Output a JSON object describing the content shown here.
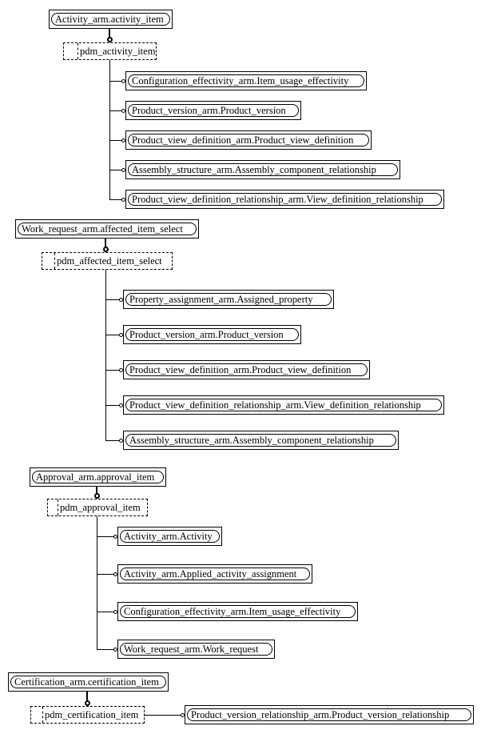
{
  "diagram": {
    "type": "EXPRESS-G select type diagram",
    "groups": [
      {
        "parent": "Activity_arm.activity_item",
        "select": "pdm_activity_item",
        "members": [
          "Configuration_effectivity_arm.Item_usage_effectivity",
          "Product_version_arm.Product_version",
          "Product_view_definition_arm.Product_view_definition",
          "Assembly_structure_arm.Assembly_component_relationship",
          "Product_view_definition_relationship_arm.View_definition_relationship"
        ]
      },
      {
        "parent": "Work_request_arm.affected_item_select",
        "select": "pdm_affected_item_select",
        "members": [
          "Property_assignment_arm.Assigned_property",
          "Product_version_arm.Product_version",
          "Product_view_definition_arm.Product_view_definition",
          "Product_view_definition_relationship_arm.View_definition_relationship",
          "Assembly_structure_arm.Assembly_component_relationship"
        ]
      },
      {
        "parent": "Approval_arm.approval_item",
        "select": "pdm_approval_item",
        "members": [
          "Activity_arm.Activity",
          "Activity_arm.Applied_activity_assignment",
          "Configuration_effectivity_arm.Item_usage_effectivity",
          "Work_request_arm.Work_request"
        ]
      },
      {
        "parent": "Certification_arm.certification_item",
        "select": "pdm_certification_item",
        "members": [
          "Product_version_relationship_arm.Product_version_relationship"
        ]
      }
    ]
  }
}
